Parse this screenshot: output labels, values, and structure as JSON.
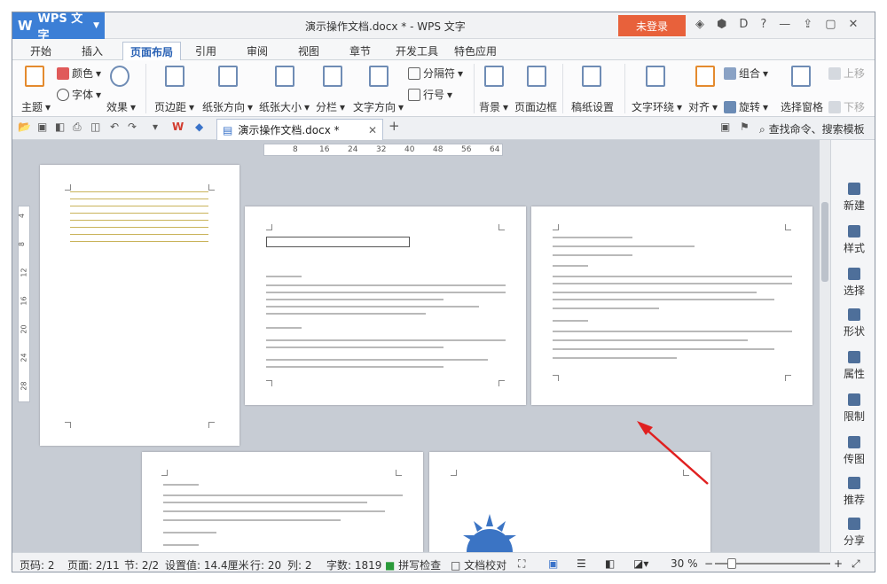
{
  "app": {
    "menu_button": "WPS 文字",
    "title": "演示操作文档.docx * - WPS 文字",
    "login_label": "未登录",
    "title_icons": [
      "shirt-icon",
      "hexagon-icon",
      "d-icon",
      "help-icon",
      "minimize-icon",
      "upload-icon",
      "maximize-icon",
      "close-icon"
    ]
  },
  "menu": {
    "tabs": [
      "开始",
      "插入",
      "页面布局",
      "引用",
      "审阅",
      "视图",
      "章节",
      "开发工具",
      "特色应用"
    ],
    "active": "页面布局"
  },
  "ribbon": {
    "theme": "主题",
    "color": "颜色",
    "font": "字体",
    "effect": "效果",
    "margin": "页边距",
    "orientation": "纸张方向",
    "size": "纸张大小",
    "columns": "分栏",
    "text_direction": "文字方向",
    "separator": "分隔符",
    "line_number": "行号",
    "background": "背景",
    "border": "页面边框",
    "grid": "稿纸设置",
    "wrap": "文字环绕",
    "align": "对齐",
    "group": "组合",
    "rotate": "旋转",
    "select_pane": "选择窗格",
    "up": "上移",
    "down": "下移"
  },
  "docbar": {
    "doc_name": "演示操作文档.docx *",
    "search_label": "查找命令、搜索模板"
  },
  "ruler": {
    "top_ticks": [
      "8",
      "16",
      "24",
      "32",
      "40",
      "48",
      "56",
      "64"
    ],
    "left_ticks": [
      "4",
      "8",
      "12",
      "16",
      "20",
      "24",
      "28"
    ]
  },
  "sidebar": {
    "items": [
      "新建",
      "样式",
      "选择",
      "形状",
      "属性",
      "限制",
      "传图",
      "推荐",
      "分享"
    ]
  },
  "status": {
    "page_code": "页码: 2",
    "page": "页面: 2/11",
    "section": "节: 2/2",
    "setting": "设置值: 14.4厘米",
    "row": "行: 20",
    "col": "列: 2",
    "words": "字数: 1819",
    "spell": "拼写检查",
    "proof": "文档校对",
    "zoom": "30 %"
  },
  "colors": {
    "menu_button_bg": "#3c7fd6",
    "login_bg": "#e8613b",
    "active_tab_text": "#2a62b5",
    "annotation_arrow": "#e02020"
  }
}
